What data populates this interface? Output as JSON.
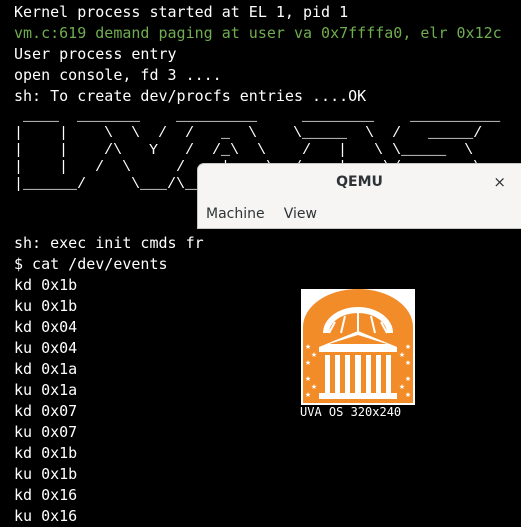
{
  "terminal": {
    "lines": [
      "Kernel process started at EL 1, pid 1",
      "vm.c:619 demand paging at user va 0x7ffffa0, elr 0x12c",
      "User process entry",
      "open console, fd 3 ....",
      "sh: To create dev/procfs entries ....OK"
    ],
    "ascii_art": " ____  _______    _________     ________    __________\n|    |    \\  \\  /  /   _  \\    \\_____  \\  /   _____/\n|    |    /\\   Y   /  /_\\  \\    /   |   \\ \\_____  \\\n|    |   /  \\     /    |    \\  /    |    \\/        \\\n|______/     \\___/\\____|__  /  \\_______  /_______  /",
    "exec_line": "sh: exec init cmds fr",
    "prompt_line": "$ cat /dev/events",
    "events": [
      "kd 0x1b",
      "ku 0x1b",
      "kd 0x04",
      "ku 0x04",
      "kd 0x1a",
      "ku 0x1a",
      "kd 0x07",
      "ku 0x07",
      "kd 0x1b",
      "ku 0x1b",
      "kd 0x16",
      "ku 0x16"
    ],
    "colors": {
      "background": "#000000",
      "text": "#ffffff",
      "warning": "#6fae4f"
    }
  },
  "qemu_window": {
    "title": "QEMU",
    "close_glyph": "×",
    "menu": [
      "Machine",
      "View"
    ],
    "background": "#f6f5f4"
  },
  "display": {
    "caption": "UVA OS 320x240",
    "logo_color": "#f28c28",
    "logo_icon": "uva-rotunda-logo-icon"
  }
}
